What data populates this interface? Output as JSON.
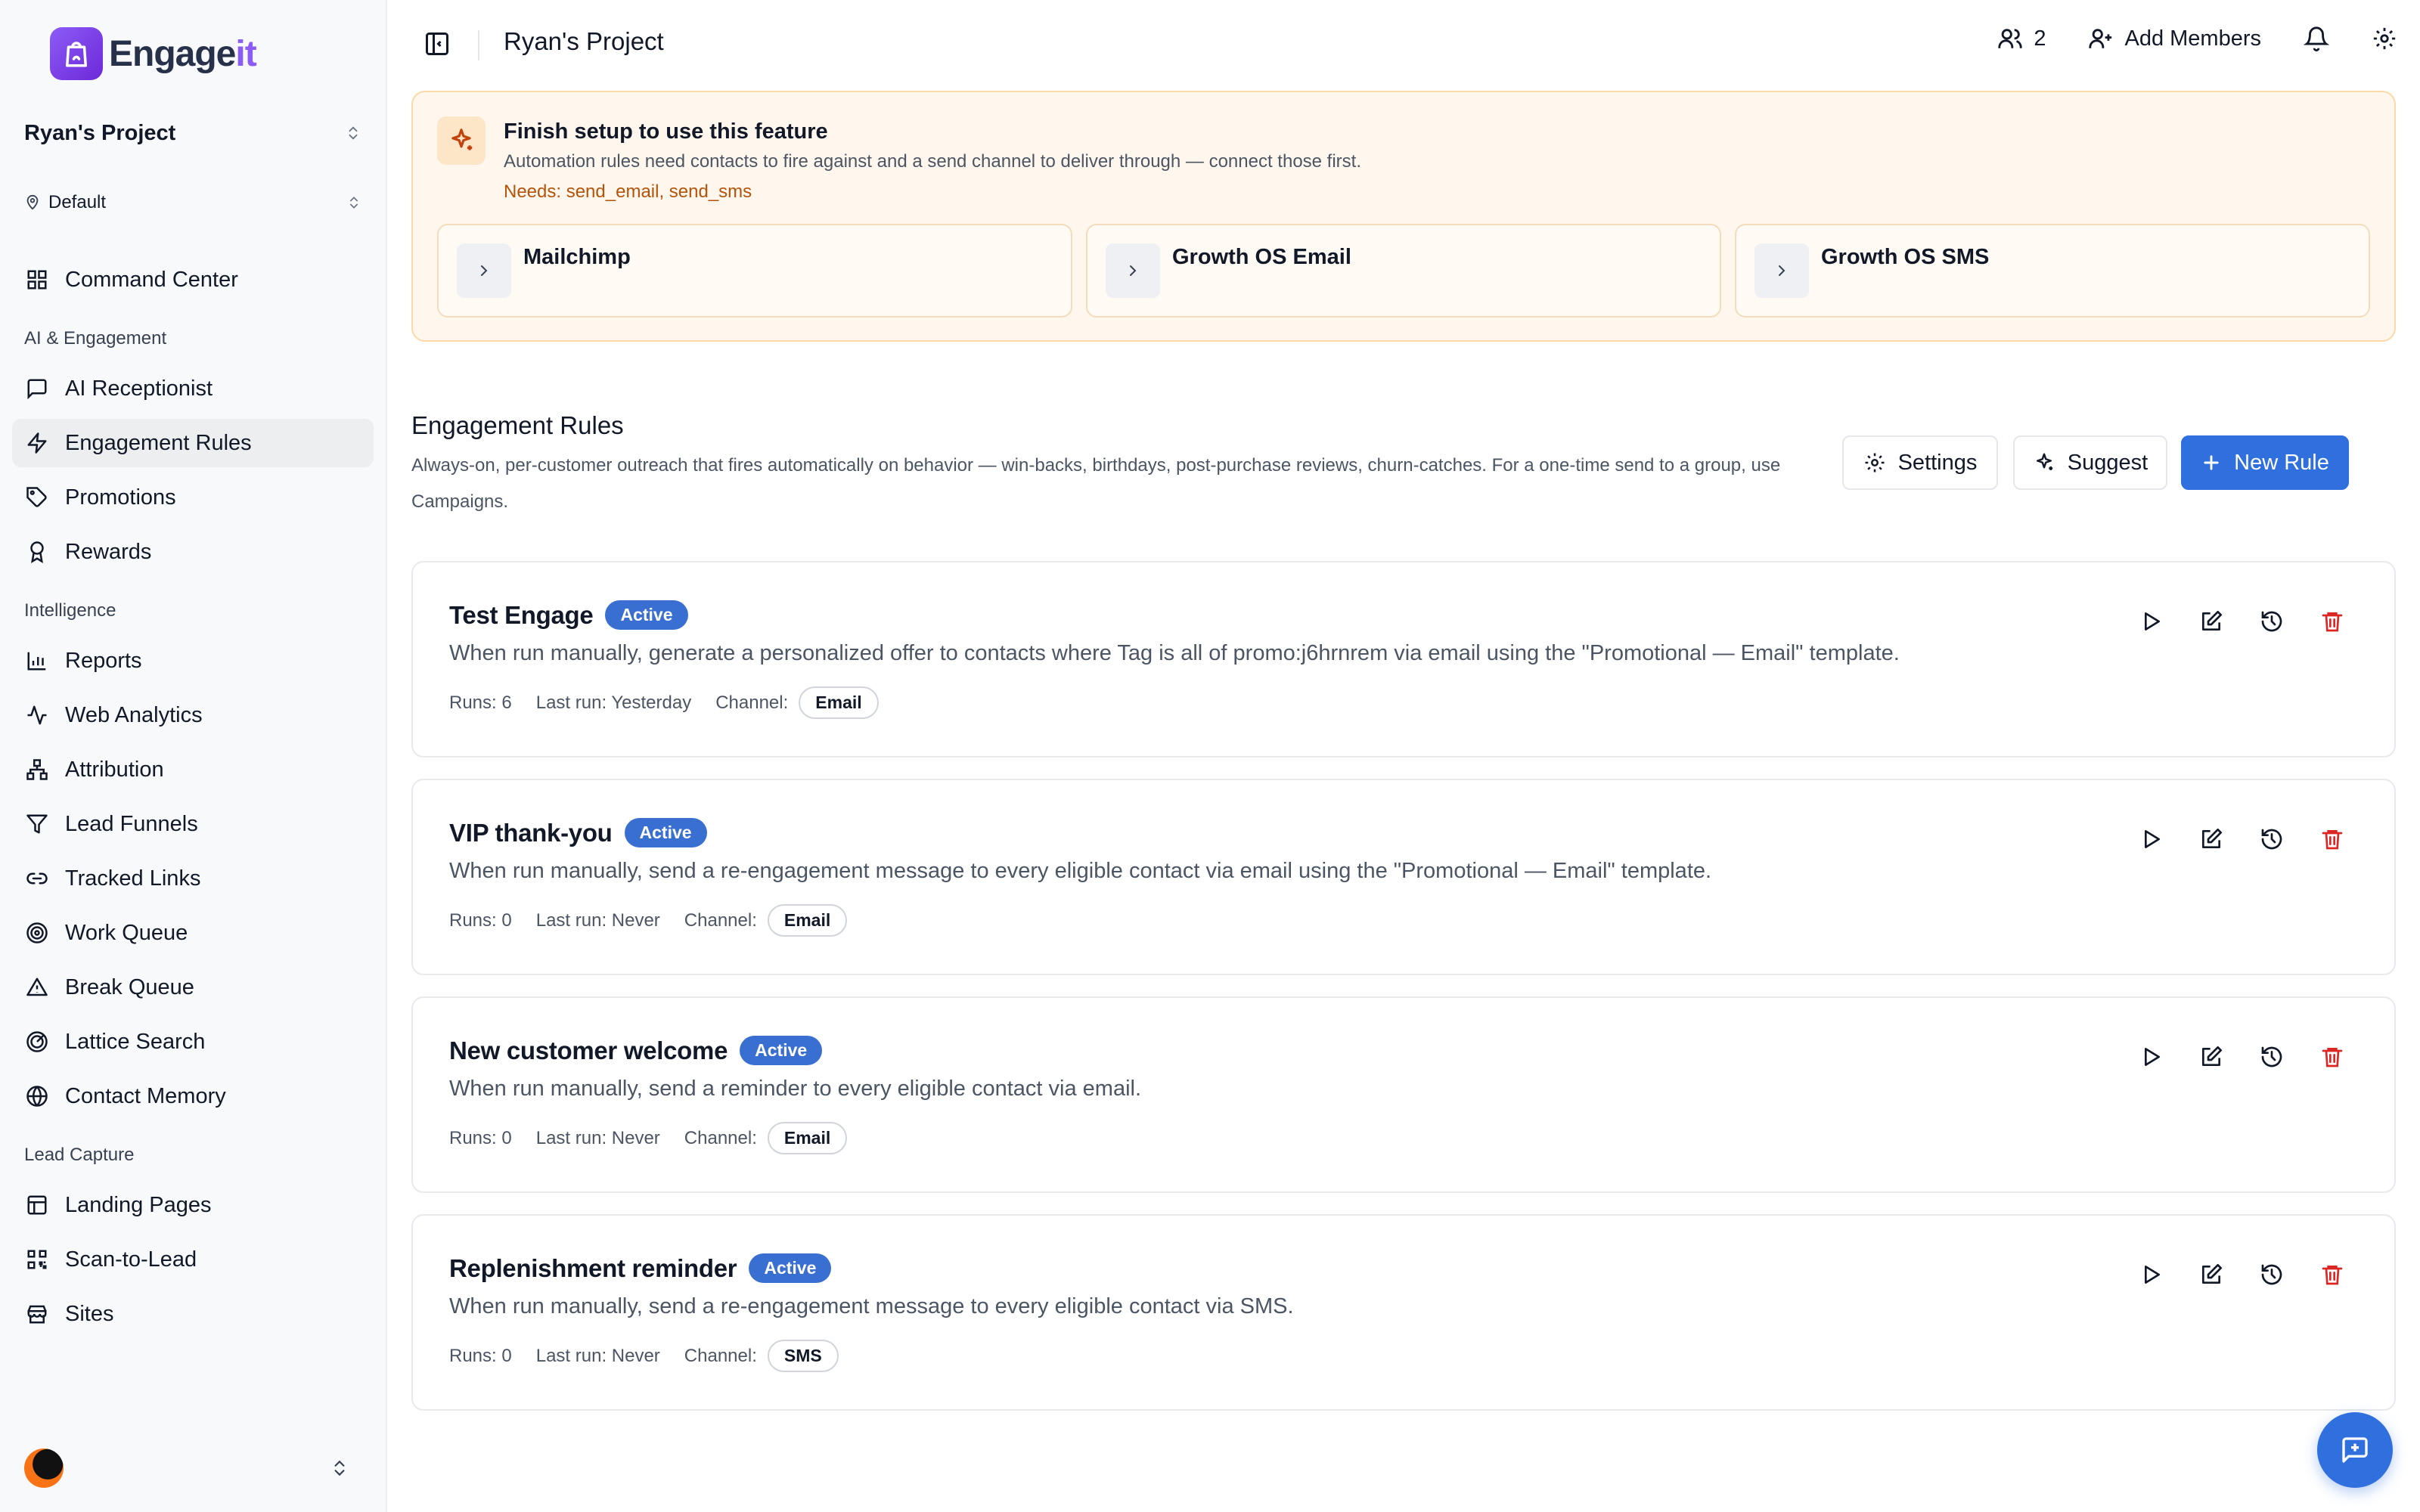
{
  "brand": {
    "name_main": "Engage",
    "name_accent": "it",
    "accent_color": "#8b5cf6"
  },
  "sidebar": {
    "project": "Ryan's Project",
    "environment": "Default",
    "top_item": {
      "label": "Command Center",
      "icon": "grid-icon"
    },
    "sections": [
      {
        "title": "AI & Engagement",
        "items": [
          {
            "label": "AI Receptionist",
            "icon": "message-square-icon"
          },
          {
            "label": "Engagement Rules",
            "icon": "zap-icon",
            "active": true
          },
          {
            "label": "Promotions",
            "icon": "tag-icon"
          },
          {
            "label": "Rewards",
            "icon": "award-icon"
          }
        ]
      },
      {
        "title": "Intelligence",
        "items": [
          {
            "label": "Reports",
            "icon": "bar-chart-icon"
          },
          {
            "label": "Web Analytics",
            "icon": "activity-icon"
          },
          {
            "label": "Attribution",
            "icon": "network-icon"
          },
          {
            "label": "Lead Funnels",
            "icon": "filter-icon"
          },
          {
            "label": "Tracked Links",
            "icon": "link-icon"
          },
          {
            "label": "Work Queue",
            "icon": "target-icon"
          },
          {
            "label": "Break Queue",
            "icon": "alert-triangle-icon"
          },
          {
            "label": "Lattice Search",
            "icon": "radar-icon"
          },
          {
            "label": "Contact Memory",
            "icon": "globe-icon"
          }
        ]
      },
      {
        "title": "Lead Capture",
        "items": [
          {
            "label": "Landing Pages",
            "icon": "layout-icon"
          },
          {
            "label": "Scan-to-Lead",
            "icon": "qr-code-icon"
          },
          {
            "label": "Sites",
            "icon": "store-icon"
          }
        ]
      }
    ]
  },
  "topbar": {
    "title": "Ryan's Project",
    "member_count": "2",
    "add_members": "Add Members"
  },
  "banner": {
    "title": "Finish setup to use this feature",
    "description": "Automation rules need contacts to fire against and a send channel to deliver through — connect those first.",
    "needs": "Needs: send_email, send_sms",
    "integrations": [
      "Mailchimp",
      "Growth OS Email",
      "Growth OS SMS"
    ]
  },
  "rules_section": {
    "title": "Engagement Rules",
    "description": "Always-on, per-customer outreach that fires automatically on behavior — win-backs, birthdays, post-purchase reviews, churn-catches. For a one-time send to a group, use Campaigns.",
    "buttons": {
      "settings": "Settings",
      "suggest": "Suggest",
      "new_rule": "New Rule"
    }
  },
  "rules": [
    {
      "name": "Test Engage",
      "status": "Active",
      "description": "When run manually, generate a personalized offer to contacts where Tag is all of promo:j6hrnrem via email using the \"Promotional — Email\" template.",
      "runs": "Runs: 6",
      "last_run": "Last run: Yesterday",
      "channel_label": "Channel:",
      "channel": "Email"
    },
    {
      "name": "VIP thank-you",
      "status": "Active",
      "description": "When run manually, send a re-engagement message to every eligible contact via email using the \"Promotional — Email\" template.",
      "runs": "Runs: 0",
      "last_run": "Last run: Never",
      "channel_label": "Channel:",
      "channel": "Email"
    },
    {
      "name": "New customer welcome",
      "status": "Active",
      "description": "When run manually, send a reminder to every eligible contact via email.",
      "runs": "Runs: 0",
      "last_run": "Last run: Never",
      "channel_label": "Channel:",
      "channel": "Email"
    },
    {
      "name": "Replenishment reminder",
      "status": "Active",
      "description": "When run manually, send a re-engagement message to every eligible contact via SMS.",
      "runs": "Runs: 0",
      "last_run": "Last run: Never",
      "channel_label": "Channel:",
      "channel": "SMS"
    }
  ],
  "colors": {
    "primary": "#2f6fde",
    "badge": "#3a6fd2",
    "danger": "#dc2626",
    "banner_bg": "#fff7ed",
    "needs_text": "#b45309"
  }
}
